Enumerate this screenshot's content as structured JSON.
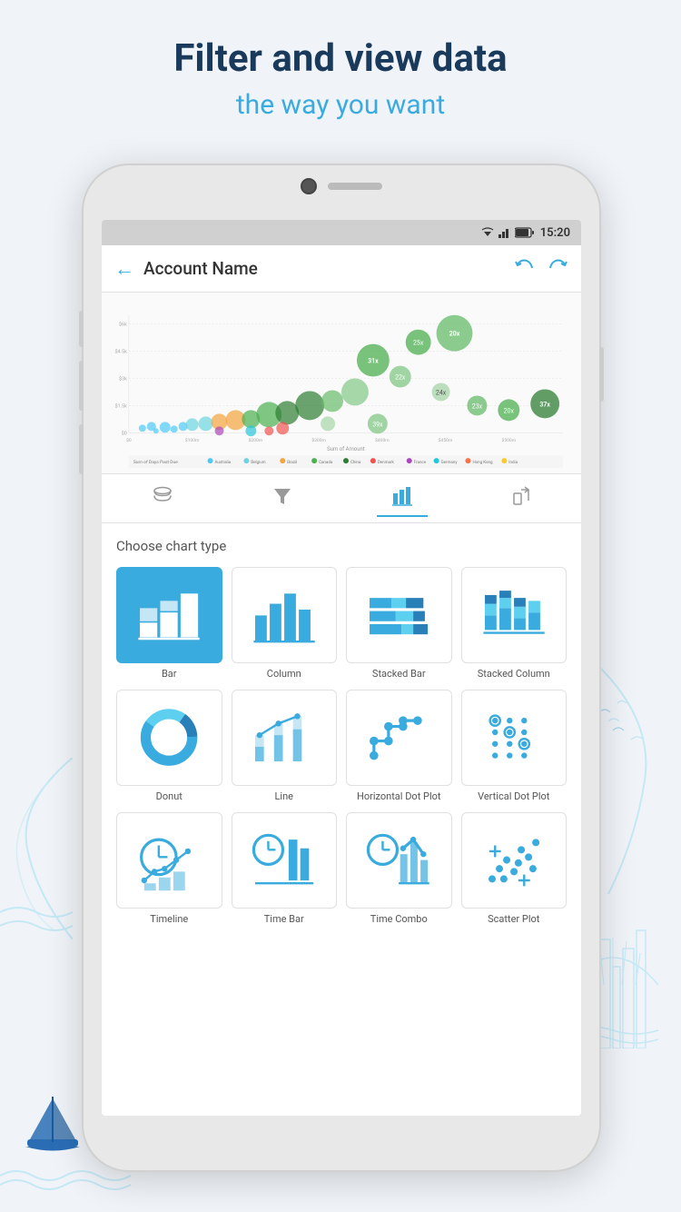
{
  "page": {
    "headline": "Filter and view data",
    "subheadline": "the way you want"
  },
  "status_bar": {
    "time": "15:20"
  },
  "app_header": {
    "title": "Account Name",
    "back_label": "←",
    "undo_label": "↩",
    "redo_label": "↪"
  },
  "toolbar": {
    "data_icon": "database",
    "filter_icon": "filter",
    "chart_icon": "chart",
    "share_icon": "share"
  },
  "chart_panel": {
    "title": "Choose chart type",
    "items": [
      {
        "id": "bar",
        "label": "Bar",
        "selected": true
      },
      {
        "id": "column",
        "label": "Column",
        "selected": false
      },
      {
        "id": "stacked-bar",
        "label": "Stacked Bar",
        "selected": false
      },
      {
        "id": "stacked-column",
        "label": "Stacked Column",
        "selected": false
      },
      {
        "id": "donut",
        "label": "Donut",
        "selected": false
      },
      {
        "id": "line",
        "label": "Line",
        "selected": false
      },
      {
        "id": "horizontal-dot-plot",
        "label": "Horizontal Dot Plot",
        "selected": false
      },
      {
        "id": "vertical-dot-plot",
        "label": "Vertical Dot Plot",
        "selected": false
      },
      {
        "id": "timeline",
        "label": "Timeline",
        "selected": false
      },
      {
        "id": "time-bar",
        "label": "Time Bar",
        "selected": false
      },
      {
        "id": "time-combo",
        "label": "Time Combo",
        "selected": false
      },
      {
        "id": "scatter-plot",
        "label": "Scatter Plot",
        "selected": false
      }
    ]
  },
  "colors": {
    "accent": "#3aabde",
    "dark_blue": "#1a3a5c",
    "selected_bg": "#3aabde",
    "border": "#e0e0e0",
    "text_secondary": "#555"
  }
}
